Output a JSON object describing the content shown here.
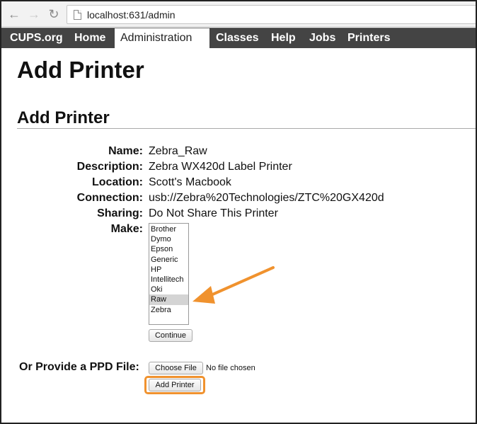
{
  "browser": {
    "url": "localhost:631/admin",
    "back_icon": "arrow-left-icon",
    "forward_icon": "arrow-right-icon",
    "reload_icon": "reload-icon",
    "page_icon": "page-icon"
  },
  "nav": {
    "items": [
      {
        "label": "CUPS.org"
      },
      {
        "label": "Home"
      },
      {
        "label": "Administration"
      },
      {
        "label": "Classes"
      },
      {
        "label": "Help"
      },
      {
        "label": "Jobs"
      },
      {
        "label": "Printers"
      }
    ],
    "active": "Administration"
  },
  "page": {
    "title": "Add Printer",
    "section_title": "Add Printer"
  },
  "form": {
    "fields": [
      {
        "label": "Name:",
        "value": "Zebra_Raw"
      },
      {
        "label": "Description:",
        "value": "Zebra WX420d Label Printer"
      },
      {
        "label": "Location:",
        "value": "Scott's Macbook"
      },
      {
        "label": "Connection:",
        "value": "usb://Zebra%20Technologies/ZTC%20GX420d"
      },
      {
        "label": "Sharing:",
        "value": "Do Not Share This Printer"
      }
    ],
    "make_label": "Make:",
    "makes": [
      "Brother",
      "Dymo",
      "Epson",
      "Generic",
      "HP",
      "Intellitech",
      "Oki",
      "Raw",
      "Zebra"
    ],
    "selected_make": "Raw",
    "continue_label": "Continue",
    "ppd_label": "Or Provide a PPD File:",
    "choose_file_label": "Choose File",
    "no_file_text": "No file chosen",
    "add_printer_label": "Add Printer"
  },
  "annotations": {
    "accent_color": "#f0922e",
    "nav_bar_color": "#444444"
  }
}
